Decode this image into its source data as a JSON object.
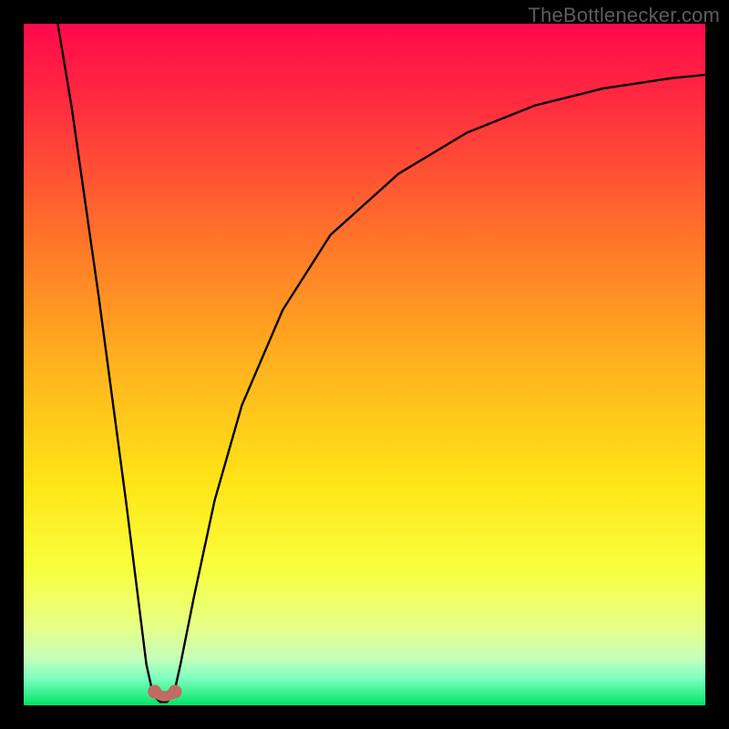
{
  "watermark": {
    "text": "TheBottlenecker.com"
  },
  "chart_data": {
    "type": "line",
    "title": "",
    "xlabel": "",
    "ylabel": "",
    "xlim": [
      0,
      100
    ],
    "ylim": [
      0,
      100
    ],
    "valley_x_range": [
      18,
      23
    ],
    "series": [
      {
        "name": "bottleneck-curve",
        "x": [
          5,
          7,
          9,
          11,
          13,
          15,
          17,
          18,
          19,
          20,
          21,
          22,
          23,
          25,
          28,
          32,
          38,
          45,
          55,
          65,
          75,
          85,
          95,
          100
        ],
        "y": [
          100,
          88,
          74,
          60,
          45,
          30,
          14,
          6,
          1.5,
          0.5,
          0.5,
          1.5,
          6,
          16,
          30,
          44,
          58,
          69,
          78,
          84,
          88,
          90.5,
          92,
          92.5
        ],
        "note": "Approximate V-shaped bottleneck percentage curve with minimum near x≈20–21; left branch near-vertical, right branch asymptotic."
      }
    ],
    "gradient_stops": [
      {
        "pct": 0,
        "color": "#ff0a4b"
      },
      {
        "pct": 12,
        "color": "#ff2d3f"
      },
      {
        "pct": 30,
        "color": "#ff6f2b"
      },
      {
        "pct": 50,
        "color": "#ffb21e"
      },
      {
        "pct": 68,
        "color": "#ffe617"
      },
      {
        "pct": 80,
        "color": "#f8ff3f"
      },
      {
        "pct": 88,
        "color": "#e8ff82"
      },
      {
        "pct": 93,
        "color": "#c7ffb9"
      },
      {
        "pct": 96,
        "color": "#7effc0"
      },
      {
        "pct": 100,
        "color": "#00e56a"
      }
    ],
    "valley_markers": [
      {
        "x": 19.2,
        "y": 2.0
      },
      {
        "x": 22.2,
        "y": 2.0
      }
    ],
    "marker_radius": 7
  }
}
